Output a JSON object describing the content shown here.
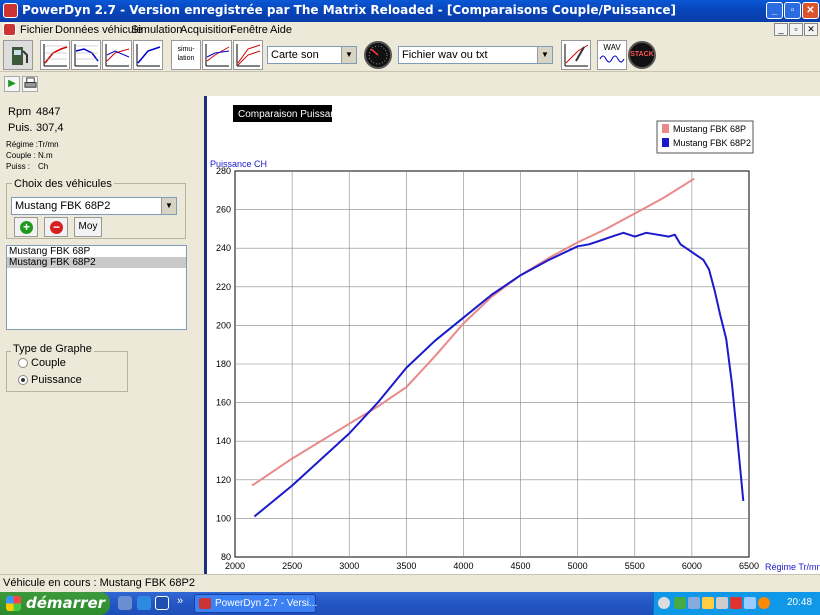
{
  "window": {
    "title": "PowerDyn 2.7 - Version enregistrée par The Matrix Reloaded - [Comparaisons Couple/Puissance]",
    "minimize": "_",
    "maximize": "▫",
    "close": "✕"
  },
  "menu": {
    "items": [
      "Fichier",
      "Données véhicule",
      "Simulation",
      "Acquisition",
      "Fenêtre",
      "Aide"
    ],
    "mdi_buttons": [
      "_",
      "▫",
      "✕"
    ]
  },
  "toolbar": {
    "simulation_label": "simu-\nlation",
    "sound_select": "Carte son",
    "file_select": "Fichier wav ou txt",
    "wav_label": "WAV",
    "stack_label": "STACK"
  },
  "left": {
    "rpm_label": "Rpm",
    "rpm_value": "4847",
    "puis_label": "Puis.",
    "puis_value": "307,4",
    "units": [
      {
        "label": "Régime :",
        "value": "Tr/mn"
      },
      {
        "label": "Couple :",
        "value": "N.m"
      },
      {
        "label": "Puiss :",
        "value": "Ch"
      }
    ],
    "choix_title": "Choix des véhicules",
    "vehicle_select": "Mustang FBK 68P2",
    "moy_label": "Moy",
    "vehicles": [
      "Mustang FBK 68P",
      "Mustang FBK 68P2"
    ],
    "graph_title": "Type de Graphe",
    "graph_options": [
      "Couple",
      "Puissance"
    ],
    "graph_selected": "Puissance"
  },
  "status": {
    "text": "Véhicule en cours : Mustang FBK 68P2"
  },
  "taskbar": {
    "start": "démarrer",
    "task": "PowerDyn 2.7 - Versi...",
    "clock": "20:48",
    "overflow": "»"
  },
  "chart_data": {
    "type": "line",
    "title": "Comparaison Puissance",
    "xlabel": "Régime Tr/mn",
    "ylabel": "Puissance CH",
    "xlim": [
      2000,
      6500
    ],
    "ylim": [
      80,
      280
    ],
    "xticks": [
      2000,
      2500,
      3000,
      3500,
      4000,
      4500,
      5000,
      5500,
      6000,
      6500
    ],
    "yticks": [
      80,
      100,
      120,
      140,
      160,
      180,
      200,
      220,
      240,
      260,
      280
    ],
    "grid": true,
    "legend_position": "top-right",
    "series": [
      {
        "name": "Mustang FBK 68P",
        "color": "#e98989",
        "x": [
          2150,
          2500,
          3000,
          3250,
          3500,
          3750,
          4000,
          4250,
          4500,
          4750,
          5000,
          5250,
          5500,
          5750,
          6020
        ],
        "y": [
          117,
          131,
          149,
          158,
          168,
          184,
          201,
          215,
          226,
          235,
          243,
          250,
          258,
          266,
          276
        ]
      },
      {
        "name": "Mustang FBK 68P2",
        "color": "#1a1acc",
        "x": [
          2170,
          2500,
          3000,
          3250,
          3500,
          3750,
          4000,
          4250,
          4500,
          4750,
          5000,
          5100,
          5200,
          5300,
          5400,
          5500,
          5600,
          5700,
          5800,
          5850,
          5900,
          6000,
          6100,
          6150,
          6200,
          6250,
          6300,
          6350,
          6400,
          6450
        ],
        "y": [
          101,
          117,
          144,
          160,
          178,
          192,
          204,
          216,
          226,
          234,
          241,
          242,
          244,
          246,
          248,
          246,
          248,
          247,
          246,
          247,
          242,
          238,
          234,
          229,
          218,
          205,
          193,
          170,
          140,
          109
        ]
      }
    ]
  }
}
